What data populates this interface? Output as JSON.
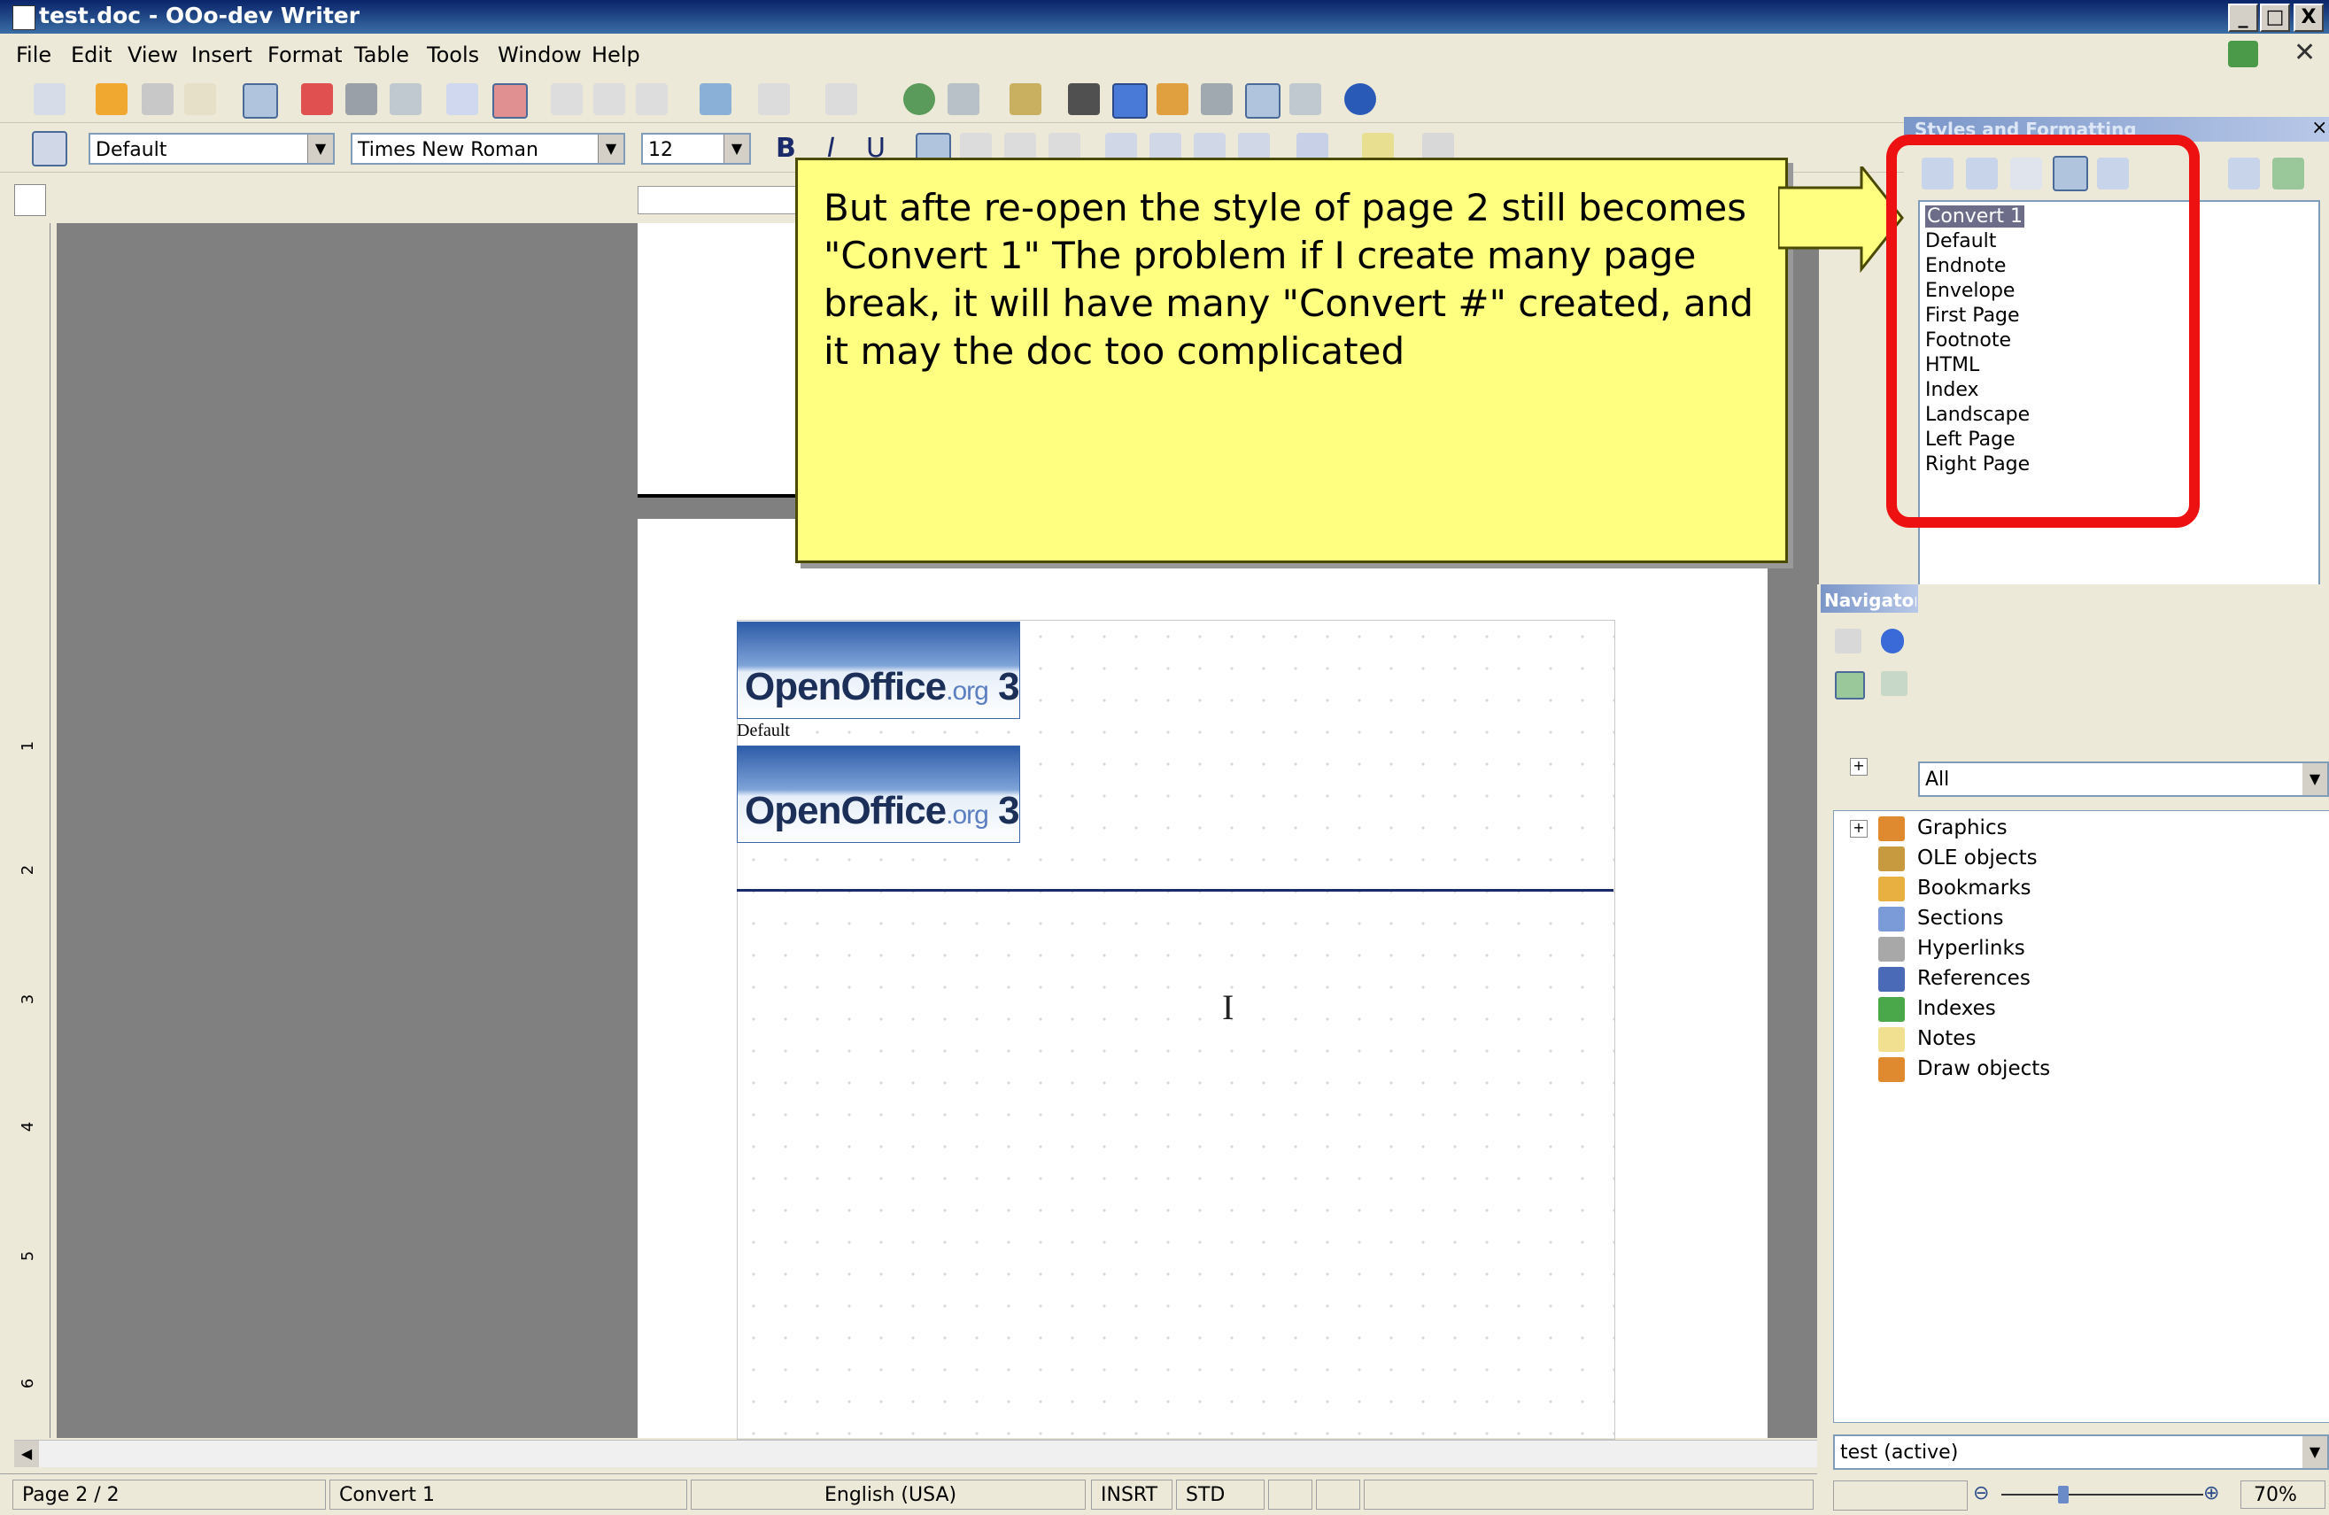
{
  "window": {
    "title": "test.doc - OOo-dev Writer",
    "min_label": "_",
    "max_label": "□",
    "close_label": "X"
  },
  "menu": [
    "File",
    "Edit",
    "View",
    "Insert",
    "Format",
    "Table",
    "Tools",
    "Window",
    "Help"
  ],
  "formatting": {
    "paragraph_style": "Default",
    "font_name": "Times New Roman",
    "font_size": "12",
    "bold": "B",
    "italic": "I",
    "underline": "U"
  },
  "callout": {
    "text": "But afte re-open the style of page 2 still becomes \"Convert 1\" The problem if I create many page break, it will have many \"Convert #\" created, and it may the doc too complicated"
  },
  "styles_panel": {
    "title": "Styles and Formatting",
    "items": [
      "Convert 1",
      "Default",
      "Endnote",
      "Envelope",
      "First Page",
      "Footnote",
      "HTML",
      "Index",
      "Landscape",
      "Left Page",
      "Right Page"
    ],
    "selected": "Convert 1",
    "filter": "All"
  },
  "navigator": {
    "title": "Navigator",
    "items": [
      "Graphics",
      "OLE objects",
      "Bookmarks",
      "Sections",
      "Hyperlinks",
      "References",
      "Indexes",
      "Notes",
      "Draw objects"
    ],
    "document": "test (active)"
  },
  "document": {
    "logo_brand": "OpenOffice",
    "logo_org": ".org",
    "logo_version": "3",
    "para_style_marker": "Default",
    "partial_logo": "Op"
  },
  "status": {
    "page": "Page 2 / 2",
    "page_style": "Convert 1",
    "language": "English (USA)",
    "insert_mode": "INSRT",
    "selection_mode": "STD",
    "zoom": "70%"
  },
  "ruler_numbers": [
    "1",
    "2",
    "3",
    "4",
    "5",
    "6"
  ],
  "colors": {
    "titlebar": "#0a246a",
    "callout_bg": "#ffff80",
    "highlight": "#ee1111"
  }
}
